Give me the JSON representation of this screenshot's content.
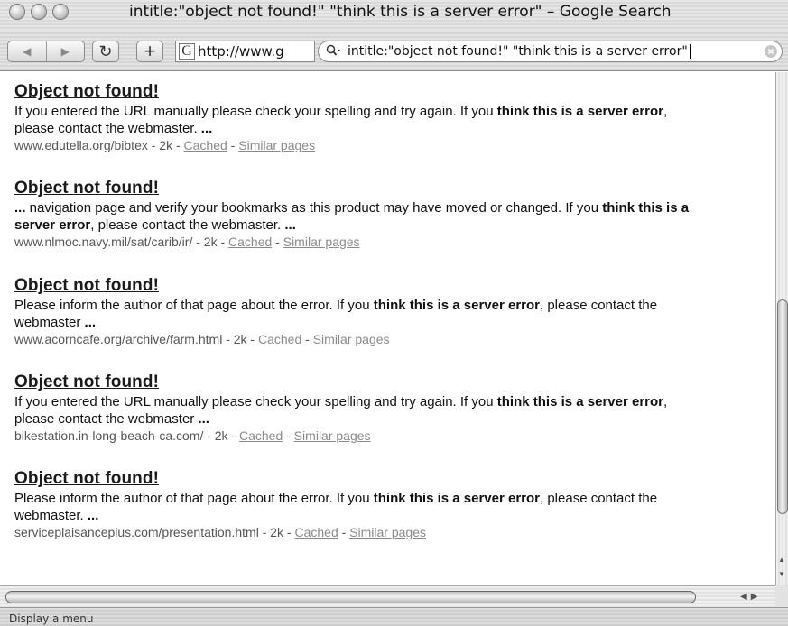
{
  "window": {
    "title": "intitle:\"object not found!\" \"think this is a server error\" – Google Search"
  },
  "toolbar": {
    "back_icon": "◀",
    "forward_icon": "▶",
    "reload_icon": "↻",
    "add_icon": "+",
    "favicon": "G",
    "url": "http://www.g",
    "search_query": "intitle:\"object not found!\" \"think this is a server error\""
  },
  "results": [
    {
      "title": "Object not found!",
      "snippet_html": "If you entered the URL manually please check your spelling and try again. If you <b>think this is a server error</b>, please contact the webmaster. <b>...</b>",
      "url": "www.edutella.org/bibtex - 2k - ",
      "cached": "Cached",
      "separator": " - ",
      "similar": "Similar pages"
    },
    {
      "title": "Object not found!",
      "snippet_html": "<b>...</b> navigation page and verify your bookmarks as this product may have moved or changed. If you <b>think this is a server error</b>, please contact the webmaster. <b>...</b>",
      "url": "www.nlmoc.navy.mil/sat/carib/ir/ - 2k - ",
      "cached": "Cached",
      "separator": " - ",
      "similar": "Similar pages"
    },
    {
      "title": "Object not found!",
      "snippet_html": "Please inform the author of that page about the error. If you <b>think this is a server error</b>, please contact the webmaster <b>...</b>",
      "url": "www.acorncafe.org/archive/farm.html - 2k - ",
      "cached": "Cached",
      "separator": " - ",
      "similar": "Similar pages"
    },
    {
      "title": "Object not found!",
      "snippet_html": "If you entered the URL manually please check your spelling and try again. If you <b>think this is a server error</b>, please contact the webmaster <b>...</b>",
      "url": "bikestation.in-long-beach-ca.com/ - 2k - ",
      "cached": "Cached",
      "separator": " - ",
      "similar": "Similar pages"
    },
    {
      "title": "Object not found!",
      "snippet_html": "Please inform the author of that page about the error. If you <b>think this is a server error</b>, please contact the webmaster. <b>...</b>",
      "url": "serviceplaisanceplus.com/presentation.html - 2k - ",
      "cached": "Cached",
      "separator": " - ",
      "similar": "Similar pages"
    }
  ],
  "statusbar": {
    "text": "Display a menu"
  }
}
